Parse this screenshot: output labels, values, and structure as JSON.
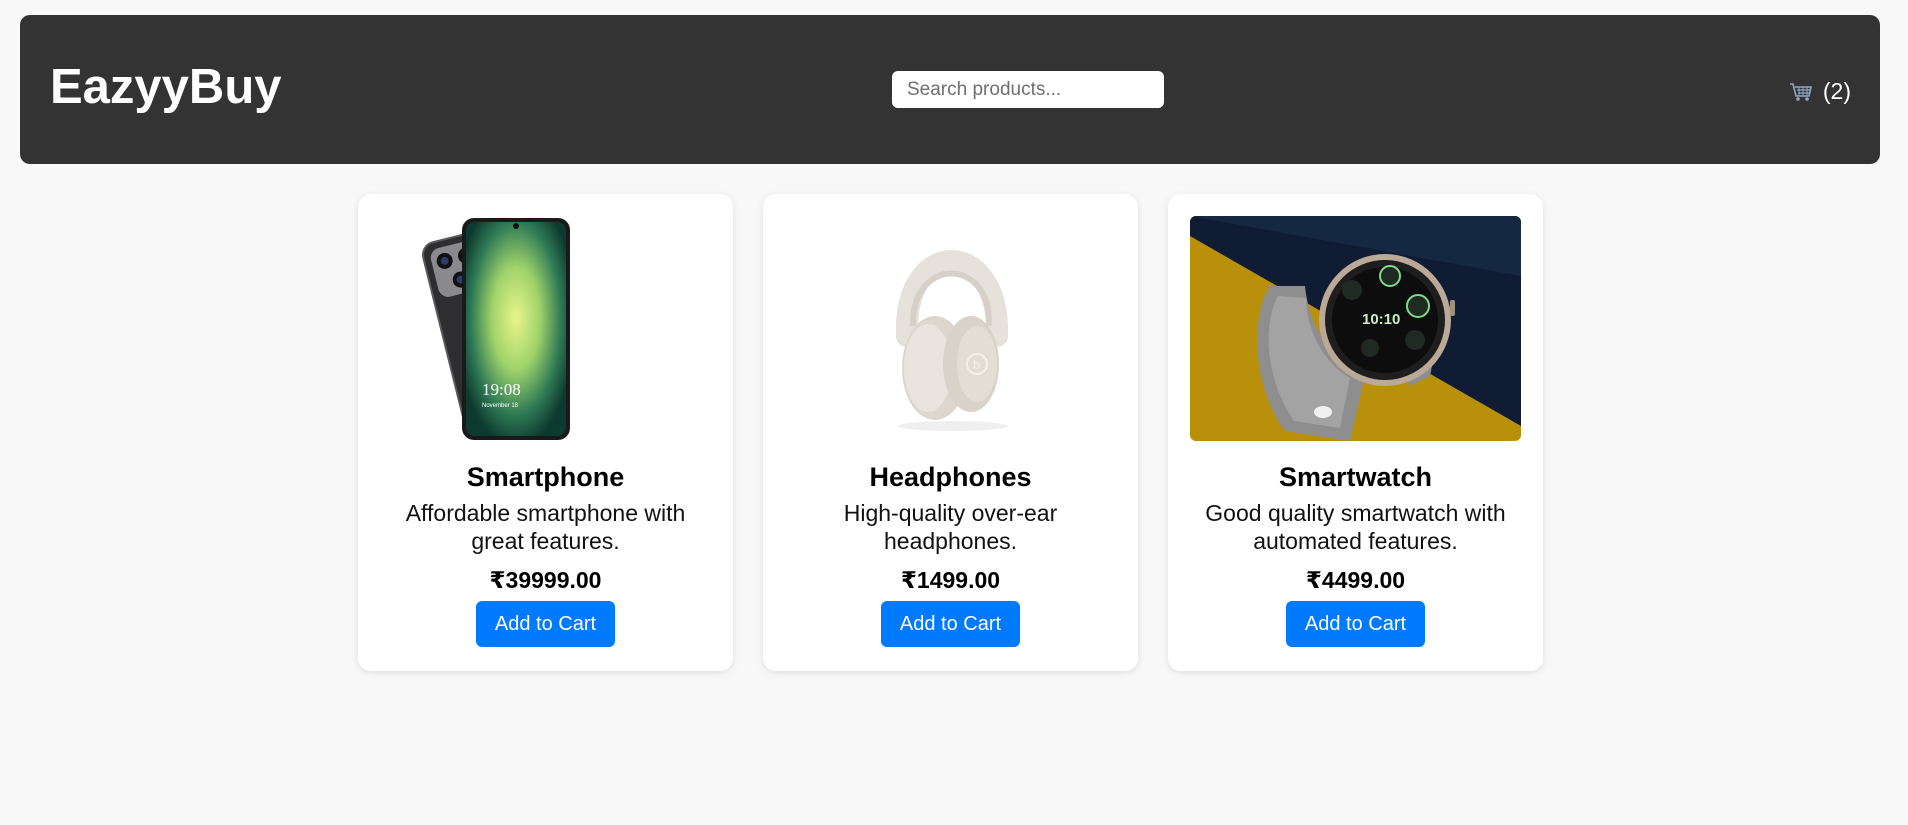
{
  "header": {
    "brand": "EazyyBuy",
    "search_placeholder": "Search products...",
    "cart_icon": "cart-icon",
    "cart_count": "(2)"
  },
  "products": [
    {
      "name": "Smartphone",
      "description": "Affordable smartphone with great features.",
      "price": "₹39999.00",
      "button": "Add to Cart",
      "image_icon": "smartphone-image",
      "phone_time": "19:08",
      "phone_date": "November 18"
    },
    {
      "name": "Headphones",
      "description": "High-quality over-ear headphones.",
      "price": "₹1499.00",
      "button": "Add to Cart",
      "image_icon": "headphones-image"
    },
    {
      "name": "Smartwatch",
      "description": "Good quality smartwatch with automated features.",
      "price": "₹4499.00",
      "button": "Add to Cart",
      "image_icon": "smartwatch-image",
      "watch_time": "10:10"
    }
  ],
  "colors": {
    "header_bg": "#333333",
    "page_bg": "#f8f8f8",
    "button_bg": "#007bff",
    "watch_bg_gold": "#b8900a",
    "watch_bg_navy": "#0f1c33"
  }
}
